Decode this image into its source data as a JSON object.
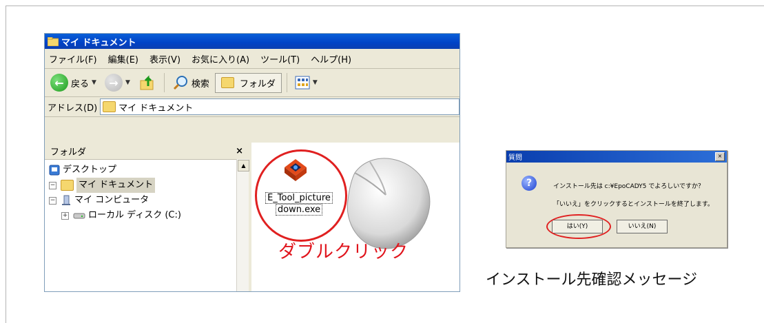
{
  "explorer": {
    "title": "マイ ドキュメント",
    "menu": [
      "ファイル(F)",
      "編集(E)",
      "表示(V)",
      "お気に入り(A)",
      "ツール(T)",
      "ヘルプ(H)"
    ],
    "toolbar": {
      "back_label": "戻る",
      "search_label": "検索",
      "folders_label": "フォルダ"
    },
    "address_label": "アドレス(D)",
    "address_value": "マイ ドキュメント",
    "folder_pane": {
      "title": "フォルダ",
      "close": "×",
      "items": [
        {
          "label": "デスクトップ"
        },
        {
          "label": "マイ ドキュメント"
        },
        {
          "label": "マイ コンピュータ"
        },
        {
          "label": "ローカル ディスク (C:)"
        }
      ]
    },
    "file": {
      "name_line1": "E_Tool_picture",
      "name_line2": "down.exe"
    }
  },
  "annotation": {
    "double_click": "ダブルクリック",
    "caption": "インストール先確認メッセージ"
  },
  "dialog": {
    "title": "質問",
    "close": "×",
    "line1": "インストール先は c:¥EpoCADY5 でよろしいですか？",
    "line2": "「いいえ」をクリックするとインストールを終了します。",
    "yes_label": "はい(Y)",
    "no_label": "いいえ(N)"
  },
  "colors": {
    "titlebar": "#0042c6",
    "annotation_red": "#e0141c"
  }
}
